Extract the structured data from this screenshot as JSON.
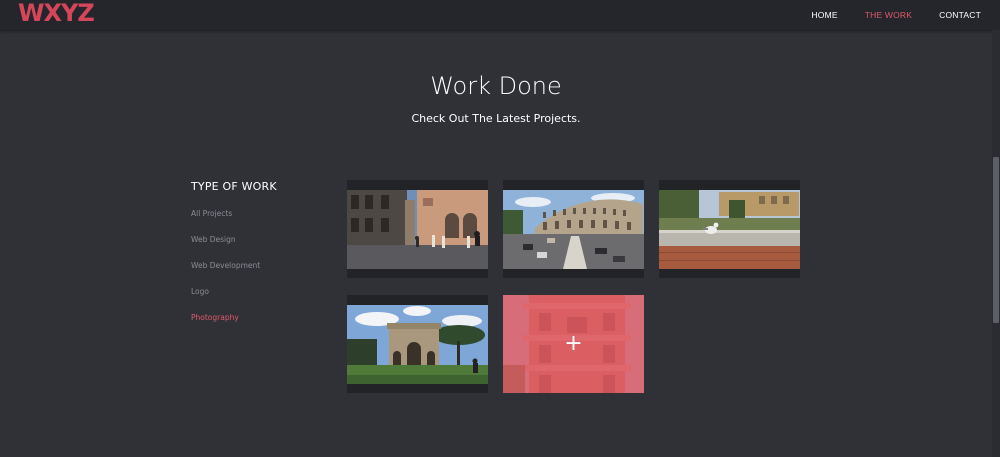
{
  "header": {
    "logo": "WXYZ",
    "nav": [
      {
        "label": "HOME",
        "active": false
      },
      {
        "label": "THE WORK",
        "active": true
      },
      {
        "label": "CONTACT",
        "active": false
      }
    ]
  },
  "main": {
    "title": "Work Done",
    "subtitle": "Check Out The Latest Projects."
  },
  "filters": {
    "heading": "TYPE OF WORK",
    "items": [
      {
        "label": "All Projects",
        "active": false
      },
      {
        "label": "Web Design",
        "active": false
      },
      {
        "label": "Web Development",
        "active": false
      },
      {
        "label": "Logo",
        "active": false
      },
      {
        "label": "Photography",
        "active": true
      }
    ]
  },
  "gallery": {
    "items": [
      {
        "subject": "street-plaza-photo"
      },
      {
        "subject": "colosseum-photo"
      },
      {
        "subject": "seagull-on-wall-photo"
      },
      {
        "subject": "arch-of-constantine-photo"
      },
      {
        "subject": "building-facade-photo",
        "hovered": true,
        "overlay_icon": "plus-icon"
      }
    ]
  },
  "colors": {
    "accent": "#e0596a",
    "background": "#2f3137",
    "navbar": "#24262b"
  }
}
